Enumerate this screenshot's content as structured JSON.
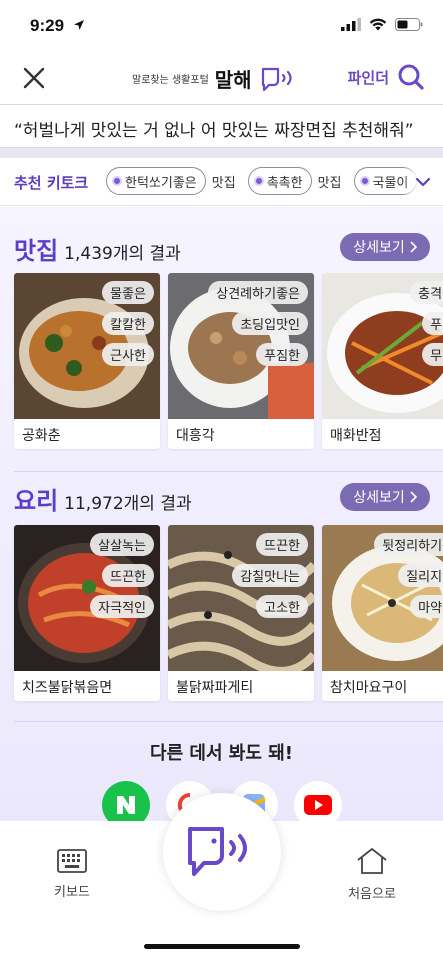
{
  "status_bar": {
    "time": "9:29"
  },
  "header": {
    "brand_sub": "말로찾는 생활포털",
    "brand_name": "말해",
    "finder_label": "파인더"
  },
  "query": {
    "text": "“허벌나게 맛있는 거 없나 어 맛있는 짜장면집 추천해줘”"
  },
  "keytalk": {
    "title": "추천 키토크",
    "chips": [
      {
        "label": "한턱쏘기좋은",
        "suffix": "맛집"
      },
      {
        "label": "촉촉한",
        "suffix": "맛집"
      },
      {
        "label": "국물이",
        "suffix": ""
      }
    ]
  },
  "restaurants": {
    "title": "맛집",
    "count": "1,439개의 결과",
    "detail_label": "상세보기",
    "items": [
      {
        "name": "공화춘",
        "tags": [
          "물좋은",
          "칼칼한",
          "근사한"
        ]
      },
      {
        "name": "대흥각",
        "tags": [
          "상견례하기좋은",
          "초딩입맛인",
          "푸짐한"
        ]
      },
      {
        "name": "매화반점",
        "tags": [
          "충격적",
          "푸짐",
          "무난"
        ]
      }
    ]
  },
  "recipes": {
    "title": "요리",
    "count": "11,972개의 결과",
    "detail_label": "상세보기",
    "items": [
      {
        "name": "치즈불닭볶음면",
        "tags": [
          "살살녹는",
          "뜨끈한",
          "자극적인"
        ]
      },
      {
        "name": "불닭짜파게티",
        "tags": [
          "뜨끈한",
          "감칠맛나는",
          "고소한"
        ]
      },
      {
        "name": "참치마요구이",
        "tags": [
          "뒷정리하기편",
          "질리지않",
          "마약같"
        ]
      }
    ]
  },
  "other": {
    "title": "다른 데서 봐도 돼!",
    "services": [
      "naver-icon",
      "google-icon",
      "maps-icon",
      "youtube-icon"
    ]
  },
  "bottom": {
    "keyboard_label": "키보드",
    "home_label": "처음으로"
  },
  "colors": {
    "accent": "#5a3ec8",
    "button": "#7b6bb3",
    "background": "#eeebfc"
  }
}
